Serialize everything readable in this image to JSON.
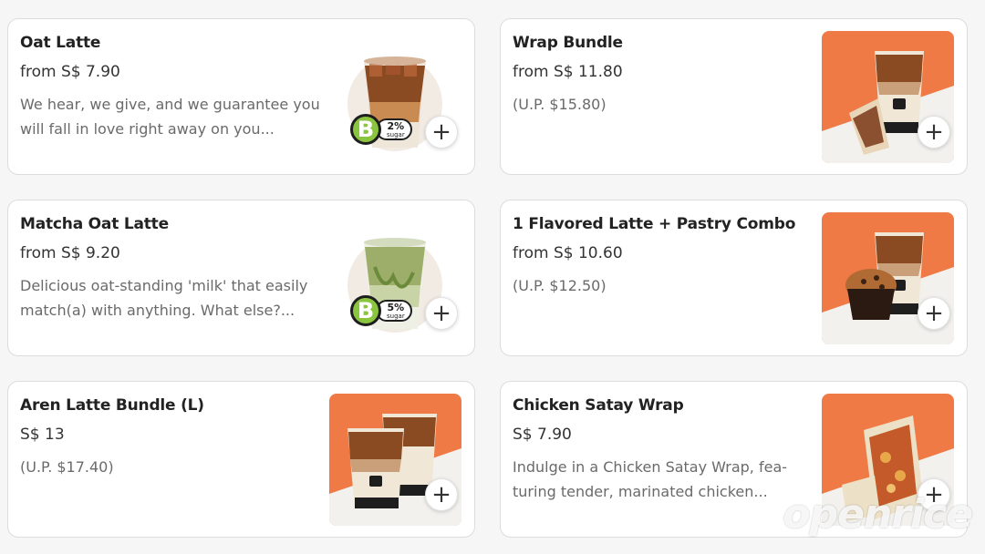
{
  "products": [
    {
      "title": "Oat Latte",
      "price": "from S$ 7.90",
      "desc": "We hear, we give, and we guarantee you will fall in love right away on you...",
      "badge": {
        "grade": "B",
        "pct": "2%",
        "label": "sugar"
      }
    },
    {
      "title": "Wrap Bundle",
      "price": "from S$ 11.80",
      "desc": "(U.P. $15.80)"
    },
    {
      "title": "Matcha Oat Latte",
      "price": "from S$ 9.20",
      "desc": "Delicious oat-standing 'milk' that easily match(a) with anything. What else?...",
      "badge": {
        "grade": "B",
        "pct": "5%",
        "label": "sugar"
      }
    },
    {
      "title": "1 Flavored Latte + Pastry Combo",
      "price": "from S$ 10.60",
      "desc": "(U.P. $12.50)"
    },
    {
      "title": "Aren Latte Bundle (L)",
      "price": "S$ 13",
      "desc": "(U.P. $17.40)"
    },
    {
      "title": "Chicken Satay Wrap",
      "price": "S$ 7.90",
      "desc": "Indulge in a Chicken Satay Wrap, fea- turing tender, marinated chicken..."
    }
  ],
  "add_label": "+",
  "watermark": "openrice",
  "colors": {
    "orange": "#ef7a45",
    "badge_green": "#8bc53f"
  }
}
